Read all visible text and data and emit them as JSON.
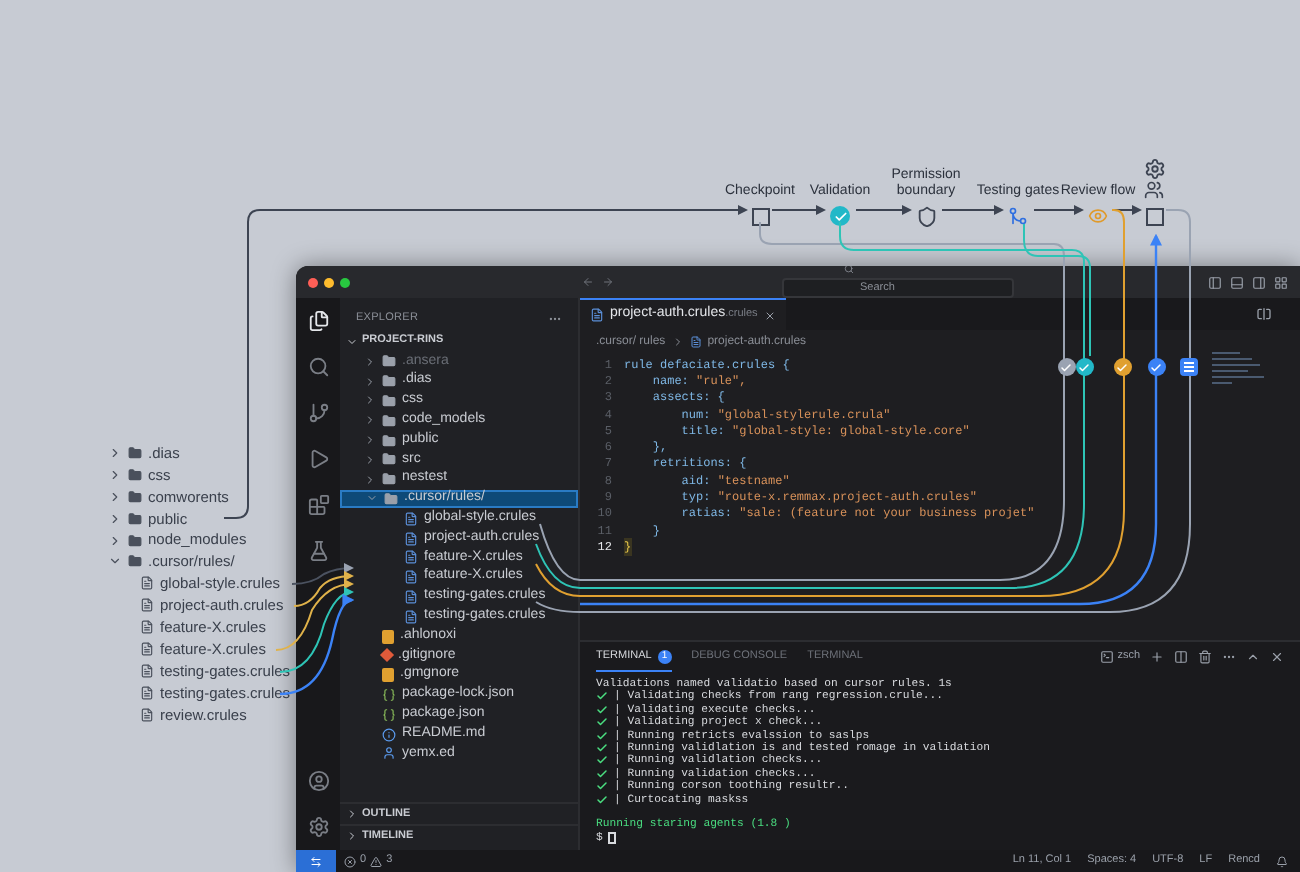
{
  "pipeline": {
    "stages": [
      {
        "label": "Checkpoint",
        "kind": "box"
      },
      {
        "label": "Validation",
        "kind": "check"
      },
      {
        "label": "Permission boundary",
        "kind": "shield"
      },
      {
        "label": "Testing gates",
        "kind": "gate"
      },
      {
        "label": "Review flow",
        "kind": "review"
      },
      {
        "kind": "team"
      }
    ]
  },
  "outer_tree": {
    "items": [
      {
        "label": ".dias",
        "expanded": false
      },
      {
        "label": "css",
        "expanded": false
      },
      {
        "label": "comworents",
        "expanded": false
      },
      {
        "label": "public",
        "expanded": false
      },
      {
        "label": "node_modules",
        "expanded": false
      },
      {
        "label": ".cursor/rules/",
        "expanded": true,
        "children": [
          {
            "label": "global-style.crules"
          },
          {
            "label": "project-auth.crules"
          },
          {
            "label": "feature-X.crules"
          },
          {
            "label": "feature-X.crules"
          },
          {
            "label": "testing-gates.crules"
          },
          {
            "label": "testing-gates.crules"
          },
          {
            "label": "review.crules"
          }
        ]
      }
    ]
  },
  "window": {
    "search": {
      "placeholder": "Search"
    },
    "activity_bar": [
      {
        "kind": "files",
        "selected": true
      },
      {
        "kind": "search",
        "selected": false
      },
      {
        "kind": "git",
        "selected": false
      },
      {
        "kind": "run",
        "selected": false
      },
      {
        "kind": "extensions",
        "selected": false
      },
      {
        "kind": "testing",
        "selected": false
      },
      {
        "kind": "account",
        "selected": false
      },
      {
        "kind": "settings",
        "selected": false
      }
    ],
    "sidebar": {
      "title": "EXPLORER",
      "root": "PROJECT-RINS",
      "items": [
        {
          "label": ".ansera",
          "kind": "folder",
          "expanded": false,
          "selected": false,
          "dimmed": true
        },
        {
          "label": ".dias",
          "kind": "folder",
          "expanded": false,
          "selected": false,
          "dimmed": false
        },
        {
          "label": "css",
          "kind": "folder",
          "expanded": false,
          "selected": false,
          "dimmed": false
        },
        {
          "label": "code_models",
          "kind": "folder",
          "expanded": false,
          "selected": false,
          "dimmed": false
        },
        {
          "label": "public",
          "kind": "folder",
          "expanded": false,
          "selected": false,
          "dimmed": false
        },
        {
          "label": "src",
          "kind": "folder",
          "expanded": false,
          "selected": false,
          "dimmed": false
        },
        {
          "label": "nestest",
          "kind": "folder",
          "expanded": false,
          "selected": false,
          "dimmed": false
        },
        {
          "label": ".cursor/rules/",
          "kind": "folder",
          "expanded": true,
          "selected": true,
          "dimmed": false,
          "children": [
            {
              "label": "global-style.crules",
              "kind": "rules"
            },
            {
              "label": "project-auth.crules",
              "kind": "rules"
            },
            {
              "label": "feature-X.crules",
              "kind": "rules"
            },
            {
              "label": "feature-X.crules",
              "kind": "rules"
            },
            {
              "label": "testing-gates.crules",
              "kind": "rules"
            },
            {
              "label": "testing-gates.crules",
              "kind": "rules"
            }
          ]
        },
        {
          "label": ".ahlonoxi",
          "kind": "config",
          "selected": false,
          "dimmed": false
        },
        {
          "label": ".gitignore",
          "kind": "git",
          "selected": false,
          "dimmed": false
        },
        {
          "label": ".gmgnore",
          "kind": "config",
          "selected": false,
          "dimmed": false
        },
        {
          "label": "package-lock.json",
          "kind": "json",
          "selected": false,
          "dimmed": false
        },
        {
          "label": "package.json",
          "kind": "json",
          "selected": false,
          "dimmed": false
        },
        {
          "label": "README.md",
          "kind": "readme",
          "selected": false,
          "dimmed": false
        },
        {
          "label": "yemx.ed",
          "kind": "user",
          "selected": false,
          "dimmed": false
        }
      ],
      "sections": [
        {
          "label": "OUTLINE",
          "expanded": false
        },
        {
          "label": "TIMELINE",
          "expanded": false
        }
      ]
    },
    "editor": {
      "tab": {
        "name": "project-auth.crules",
        "suffix": ".crules"
      },
      "breadcrumb": [
        ".cursor/ rules",
        "project-auth.crules"
      ],
      "lines": [
        {
          "num": "1",
          "code": "rule defaciate.crules {",
          "current": false
        },
        {
          "num": "2",
          "code": "    name: ",
          "string": "\"rule\",",
          "current": false
        },
        {
          "num": "3",
          "code": "    assects: {",
          "current": false
        },
        {
          "num": "4",
          "code": "        num: ",
          "string": "\"global-stylerule.crula\"",
          "current": false
        },
        {
          "num": "5",
          "code": "        title: ",
          "string": "\"global-style: global-style.core\"",
          "current": false
        },
        {
          "num": "6",
          "code": "    },",
          "current": false
        },
        {
          "num": "7",
          "code": "    retritions: {",
          "current": false
        },
        {
          "num": "8",
          "code": "        aid: ",
          "string": "\"testname\"",
          "current": false
        },
        {
          "num": "9",
          "code": "        typ: ",
          "string": "\"route-x.remmax.project-auth.crules\"",
          "current": false
        },
        {
          "num": "10",
          "code": "        ratias: ",
          "string": "\"sale: (feature not your business projet\"",
          "current": false
        },
        {
          "num": "11",
          "code": "    }",
          "current": false
        },
        {
          "num": "12",
          "code": "}",
          "current": true
        }
      ]
    },
    "panel": {
      "tabs": [
        {
          "label": "TERMINAL",
          "badge": "1",
          "selected": true
        },
        {
          "label": "DEBUG CONSOLE",
          "selected": false
        },
        {
          "label": "TERMINAL",
          "selected": false
        }
      ],
      "shell": "zsch",
      "lines": [
        {
          "kind": "plain",
          "text": "Validations named validatio based on cursor rules. 1s"
        },
        {
          "kind": "check",
          "text": "| Validating checks from rang regression.crule..."
        },
        {
          "kind": "check",
          "text": "| Validating execute checks..."
        },
        {
          "kind": "check",
          "text": "| Validating project x check..."
        },
        {
          "kind": "check",
          "text": "| Running retricts evalssion to saslps"
        },
        {
          "kind": "check",
          "text": "| Running validlation is and tested romage in validation"
        },
        {
          "kind": "check",
          "text": "| Running validlation checks..."
        },
        {
          "kind": "check",
          "text": "| Running validation checks..."
        },
        {
          "kind": "check",
          "text": "| Running corson toothing resultr.."
        },
        {
          "kind": "check",
          "text": "| Curtocating maskss"
        },
        {
          "kind": "gap"
        },
        {
          "kind": "success",
          "text": "Running staring agents (1.8 )"
        },
        {
          "kind": "prompt",
          "text": "$"
        }
      ]
    },
    "status_bar": {
      "errors": "0",
      "warnings": "3",
      "right": [
        "Ln 11, Col 1",
        "Spaces: 4",
        "UTF-8",
        "LF",
        "Rencd"
      ]
    }
  }
}
